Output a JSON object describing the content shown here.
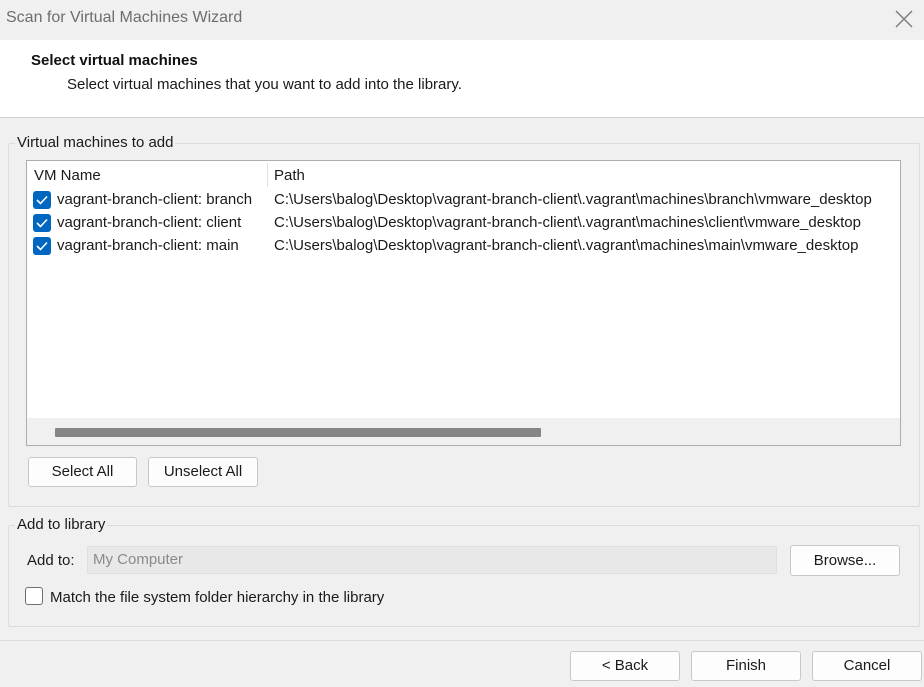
{
  "window": {
    "title": "Scan for Virtual Machines Wizard"
  },
  "header": {
    "title": "Select virtual machines",
    "subtitle": "Select virtual machines that you want to add into the library."
  },
  "vm_group": {
    "legend": "Virtual machines to add",
    "columns": {
      "name": "VM Name",
      "path": "Path"
    },
    "rows": [
      {
        "name": "vagrant-branch-client: branch",
        "path": "C:\\Users\\balog\\Desktop\\vagrant-branch-client\\.vagrant\\machines\\branch\\vmware_desktop",
        "checked": true
      },
      {
        "name": "vagrant-branch-client: client",
        "path": "C:\\Users\\balog\\Desktop\\vagrant-branch-client\\.vagrant\\machines\\client\\vmware_desktop",
        "checked": true
      },
      {
        "name": "vagrant-branch-client: main",
        "path": "C:\\Users\\balog\\Desktop\\vagrant-branch-client\\.vagrant\\machines\\main\\vmware_desktop",
        "checked": true
      }
    ],
    "select_all": "Select All",
    "unselect_all": "Unselect All"
  },
  "library_group": {
    "legend": "Add to library",
    "add_to_label": "Add to:",
    "add_to_value": "My Computer",
    "browse": "Browse...",
    "match_hierarchy_label": "Match the file system folder hierarchy in the library",
    "match_hierarchy_checked": false
  },
  "footer": {
    "back": "< Back",
    "finish": "Finish",
    "cancel": "Cancel"
  },
  "colors": {
    "accent": "#0067c0",
    "background": "#f0f0f0"
  },
  "icons": {
    "close": "close-icon",
    "check": "checkmark-icon"
  }
}
